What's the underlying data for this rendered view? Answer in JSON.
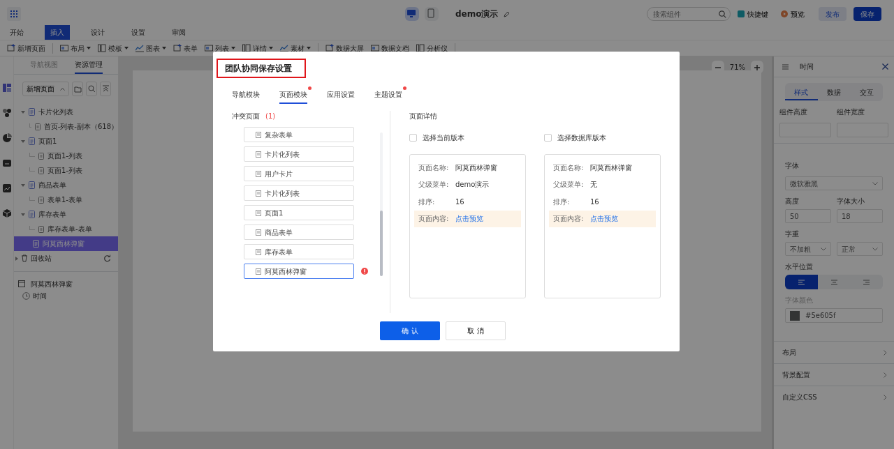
{
  "topbar": {
    "title": "demo演示",
    "search_placeholder": "搜索组件",
    "shortcut": "快捷键",
    "preview": "预览",
    "publish": "发布",
    "save": "保存",
    "devices": [
      {
        "kind": "desktop",
        "selected": true
      },
      {
        "kind": "tablet",
        "selected": false
      }
    ]
  },
  "menu_tabs": [
    {
      "label": "开始",
      "selected": false
    },
    {
      "label": "插入",
      "selected": true
    },
    {
      "label": "设计",
      "selected": false
    },
    {
      "label": "设置",
      "selected": false
    },
    {
      "label": "审阅",
      "selected": false
    }
  ],
  "toolbar": [
    {
      "label": "新增页面",
      "dropdown": false,
      "divider_after": true
    },
    {
      "label": "布局",
      "dropdown": true,
      "divider_after": false
    },
    {
      "label": "模板",
      "dropdown": true,
      "divider_after": false
    },
    {
      "label": "图表",
      "dropdown": true,
      "divider_after": false
    },
    {
      "label": "表单",
      "dropdown": false,
      "divider_after": false
    },
    {
      "label": "列表",
      "dropdown": true,
      "divider_after": false
    },
    {
      "label": "详情",
      "dropdown": true,
      "divider_after": false
    },
    {
      "label": "素材",
      "dropdown": true,
      "divider_after": true
    },
    {
      "label": "数据大屏",
      "dropdown": false,
      "divider_after": false
    },
    {
      "label": "数据文档",
      "dropdown": false,
      "divider_after": false
    },
    {
      "label": "分析仪",
      "dropdown": false,
      "divider_after": true
    }
  ],
  "left_panel": {
    "tabs": [
      {
        "label": "导航视图",
        "selected": false
      },
      {
        "label": "资源管理",
        "selected": true
      }
    ],
    "new_page_button": "新增页面",
    "tree": [
      {
        "label": "卡片化列表",
        "expanded": true,
        "selected": false,
        "children": [
          {
            "label": "首页-列表-副本（618）",
            "selected": false
          }
        ]
      },
      {
        "label": "页面1",
        "expanded": true,
        "selected": false,
        "children": [
          {
            "label": "页面1-列表",
            "selected": false
          },
          {
            "label": "页面1-列表",
            "selected": false
          }
        ]
      },
      {
        "label": "商品表单",
        "expanded": true,
        "selected": false,
        "children": [
          {
            "label": "表单1-表单",
            "selected": false
          }
        ]
      },
      {
        "label": "库存表单",
        "expanded": true,
        "selected": false,
        "children": [
          {
            "label": "库存表单-表单",
            "selected": false
          }
        ]
      },
      {
        "label": "阿莫西林弹窗",
        "expanded": false,
        "selected": true
      }
    ],
    "recycle_bin": "回收站",
    "component_tree": {
      "label": "阿莫西林弹窗",
      "children": [
        {
          "label": "时间"
        }
      ]
    }
  },
  "canvas": {
    "zoom": "71%"
  },
  "right_panel": {
    "title": "时间",
    "tabs": [
      {
        "label": "样式",
        "selected": true
      },
      {
        "label": "数据",
        "selected": false
      },
      {
        "label": "交互",
        "selected": false
      }
    ],
    "size_labels": [
      "组件高度",
      "组件宽度"
    ],
    "font_label": "字体",
    "font_value": "微软雅黑",
    "height_label": "高度",
    "height_value": "50",
    "font_size_label": "字体大小",
    "font_size_value": "18",
    "weight_label": "字重",
    "weight_values": [
      "不加粗",
      "正常"
    ],
    "align_label": "水平位置",
    "align": [
      {
        "kind": "left",
        "selected": true
      },
      {
        "kind": "center",
        "selected": false
      },
      {
        "kind": "right",
        "selected": false
      }
    ],
    "color_label": "字体颜色",
    "color_value": "#5e605f",
    "sections": [
      "布局",
      "背景配置",
      "自定义CSS"
    ]
  },
  "dialog": {
    "title": "团队协同保存设置",
    "tabs": [
      {
        "label": "导航模块",
        "selected": false,
        "dot": false
      },
      {
        "label": "页面模块",
        "selected": true,
        "dot": true
      },
      {
        "label": "应用设置",
        "selected": false,
        "dot": false
      },
      {
        "label": "主题设置",
        "selected": false,
        "dot": true
      }
    ],
    "conflict_label": "冲突页面",
    "conflict_count": "(1)",
    "pages": [
      {
        "label": "复杂表单",
        "selected": false,
        "conflict": false
      },
      {
        "label": "卡片化列表",
        "selected": false,
        "conflict": false
      },
      {
        "label": "用户卡片",
        "selected": false,
        "conflict": false
      },
      {
        "label": "卡片化列表",
        "selected": false,
        "conflict": false
      },
      {
        "label": "页面1",
        "selected": false,
        "conflict": false
      },
      {
        "label": "商品表单",
        "selected": false,
        "conflict": false
      },
      {
        "label": "库存表单",
        "selected": false,
        "conflict": false
      },
      {
        "label": "阿莫西林弹窗",
        "selected": true,
        "conflict": true
      }
    ],
    "details_label": "页面详情",
    "versions": [
      {
        "checkbox_label": "选择当前版本",
        "checked": false,
        "rows": [
          {
            "label": "页面名称:",
            "value": "阿莫西林弹窗",
            "kind": "text"
          },
          {
            "label": "父级菜单:",
            "value": "demo演示",
            "kind": "text"
          },
          {
            "label": "排序:",
            "value": "16",
            "kind": "text"
          },
          {
            "label": "页面内容:",
            "value": "点击预览",
            "kind": "link"
          }
        ]
      },
      {
        "checkbox_label": "选择数据库版本",
        "checked": false,
        "rows": [
          {
            "label": "页面名称:",
            "value": "阿莫西林弹窗",
            "kind": "text"
          },
          {
            "label": "父级菜单:",
            "value": "无",
            "kind": "text"
          },
          {
            "label": "排序:",
            "value": "16",
            "kind": "text"
          },
          {
            "label": "页面内容:",
            "value": "点击预览",
            "kind": "link"
          }
        ]
      }
    ],
    "confirm": "确 认",
    "cancel": "取 消"
  }
}
